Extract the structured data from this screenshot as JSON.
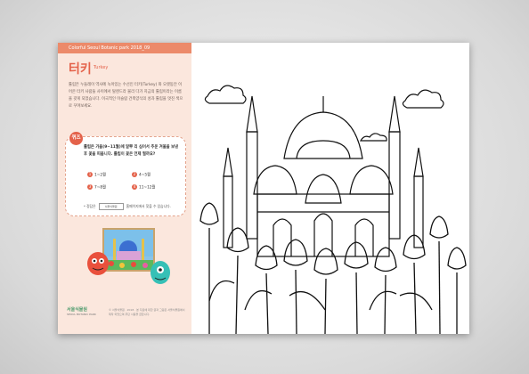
{
  "header": {
    "series": "Colorful Seoul Botanic park 2018_09"
  },
  "title": {
    "main": "터키",
    "sub": "Turkey"
  },
  "description": "튤립은 누들레이 역사에 녹아있는 수선인 터키(Turkey) 와 오랫동안 이어온 터키 사람들 사이에서 탈렌드라 불리 다가 지금의 튤립이라는 이름을 갖게 되었습니다. 이국적인 이슬람 건축양식의 성과 튤립을 멋진 색으로 꾸며보세요.",
  "quiz": {
    "badge": "퀴즈",
    "question": "튤립은 가을(9~11월)에 알뿌 리 심어서 추운 겨울을 보낸 후 꽃을 피웁니다. 튤립이 꽃은 언제 필까요?",
    "options": [
      {
        "num": "1",
        "text": "1~2월"
      },
      {
        "num": "2",
        "text": "4~5월"
      },
      {
        "num": "3",
        "text": "7~8월"
      },
      {
        "num": "4",
        "text": "11~12월"
      }
    ],
    "answer_label": "* 정답은",
    "answer_box": "서울식물원",
    "answer_suffix": "홈페이지에서 찾을 수 있습니다."
  },
  "logo": {
    "name": "서울식물원",
    "en": "SEOUL BOTANIC PARK"
  },
  "footer": "© 서울식물원 · 2018 · 본 자료에 대한 글과 그림은 서울식물원에서 제작 되었으며 무단 사용을 금합니다."
}
